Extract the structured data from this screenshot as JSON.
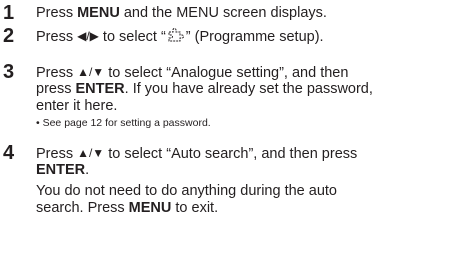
{
  "steps": [
    {
      "number": "1",
      "press": "Press ",
      "key": "MENU",
      "rest": " and the MENU screen displays."
    },
    {
      "number": "2",
      "press": "Press ",
      "arrows": "◀/▶",
      "mid": " to select “",
      "icon": "programme-setup-icon",
      "end": "” (Programme setup)."
    },
    {
      "number": "3",
      "line1_press": "Press ",
      "line1_arrows": "▲/▼",
      "line1_rest": " to select “Analogue setting”, and then",
      "line2_press": "press ",
      "line2_key": "ENTER",
      "line2_rest": ". If you have already set the password,",
      "line3": "enter it here.",
      "bullet": "• See page 12 for setting a password."
    },
    {
      "number": "4",
      "line1_press": "Press ",
      "line1_arrows": "▲/▼",
      "line1_rest": " to select “Auto search”, and then press",
      "line2_key": "ENTER",
      "line2_rest": ".",
      "para_line1": "You do not need to do anything during the auto",
      "para_line2_start": "search. Press ",
      "para_line2_key": "MENU",
      "para_line2_end": " to exit."
    }
  ]
}
